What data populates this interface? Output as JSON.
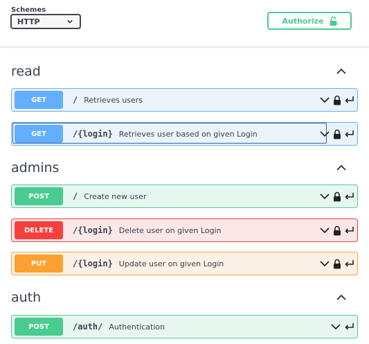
{
  "schemes": {
    "label": "Schemes",
    "selected": "HTTP"
  },
  "authorize": {
    "label": "Authorize"
  },
  "tags": [
    {
      "name": "read",
      "operations": [
        {
          "method": "GET",
          "path": "/",
          "summary": "Retrieves users",
          "locked": true
        },
        {
          "method": "GET",
          "path": "/{login}",
          "summary": "Retrieves user based on given Login",
          "locked": true
        }
      ]
    },
    {
      "name": "admins",
      "operations": [
        {
          "method": "POST",
          "path": "/",
          "summary": "Create new user",
          "locked": true
        },
        {
          "method": "DELETE",
          "path": "/{login}",
          "summary": "Delete user on given Login",
          "locked": true
        },
        {
          "method": "PUT",
          "path": "/{login}",
          "summary": "Update user on given Login",
          "locked": true
        }
      ]
    },
    {
      "name": "auth",
      "operations": [
        {
          "method": "POST",
          "path": "/auth/",
          "summary": "Authentication",
          "locked": false
        }
      ]
    }
  ],
  "colors": {
    "get": "#61affe",
    "post": "#49cc90",
    "delete": "#f93e3e",
    "put": "#fca130"
  }
}
